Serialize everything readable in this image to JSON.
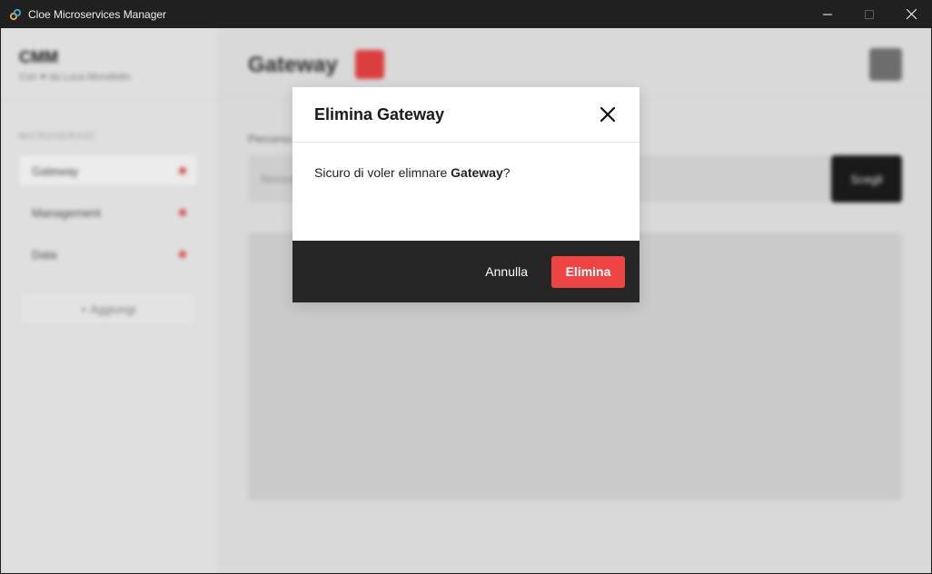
{
  "window": {
    "title": "Cloe Microservices Manager",
    "icon": "link-icon"
  },
  "sidebar": {
    "brand": "CMM",
    "credit": "Con ♥ da Luca Morsiletto",
    "section_label": "MICROSERVIZI",
    "items": [
      {
        "label": "Gateway",
        "status_color": "#e85c5c"
      },
      {
        "label": "Management",
        "status_color": "#e85c5c"
      },
      {
        "label": "Data",
        "status_color": "#e85c5c"
      }
    ],
    "add_label": "+ Aggiungi"
  },
  "main": {
    "title": "Gateway",
    "path_label": "Percorso",
    "path_placeholder": "Nessun percorso selezionato",
    "choose_label": "Scegli"
  },
  "modal": {
    "title": "Elimina Gateway",
    "body_prefix": "Sicuro di voler elimnare ",
    "body_name": "Gateway",
    "body_suffix": "?",
    "cancel_label": "Annulla",
    "confirm_label": "Elimina"
  },
  "colors": {
    "accent_red": "#ef4444",
    "footer_dark": "#262626",
    "titlebar": "#202020"
  }
}
